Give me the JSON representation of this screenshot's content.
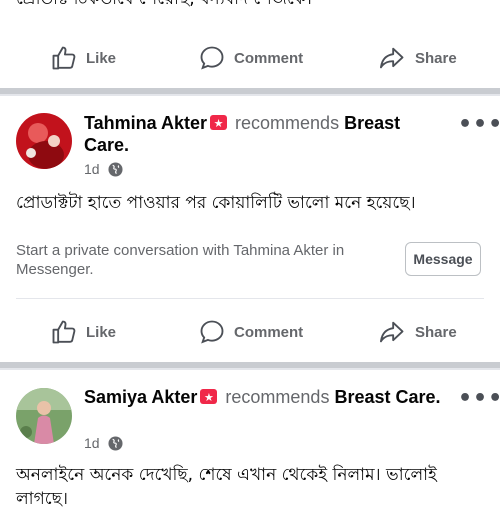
{
  "previous_post": {
    "text_tail": "প্রোডাক্ট ঠিকভাবে পেয়েছি, ধন্যবাদ পেজকে।"
  },
  "actions": {
    "like_label": "Like",
    "comment_label": "Comment",
    "share_label": "Share"
  },
  "posts": [
    {
      "author": "Tahmina Akter",
      "recommends_word": "recommends",
      "page_name": "Breast Care",
      "page_name_end": ".",
      "time": "1d",
      "body": "প্রোডাক্টটা হাতে পাওয়ার পর কোয়ালিটি ভালো মনে হয়েছে।",
      "message_prompt": "Start a private conversation with Tahmina Akter in Messenger.",
      "message_button": "Message",
      "more": "•••"
    },
    {
      "author": "Samiya Akter",
      "recommends_word": "recommends",
      "page_name": "Breast Care",
      "page_name_end": ".",
      "time": "1d",
      "body": "অনলাইনে অনেক দেখেছি, শেষে এখান থেকেই নিলাম। ভালোই লাগছে।",
      "more": "•••"
    }
  ],
  "colors": {
    "secondary_text": "#65676b",
    "badge_red": "#f02849",
    "separator": "#c9ccd1"
  }
}
